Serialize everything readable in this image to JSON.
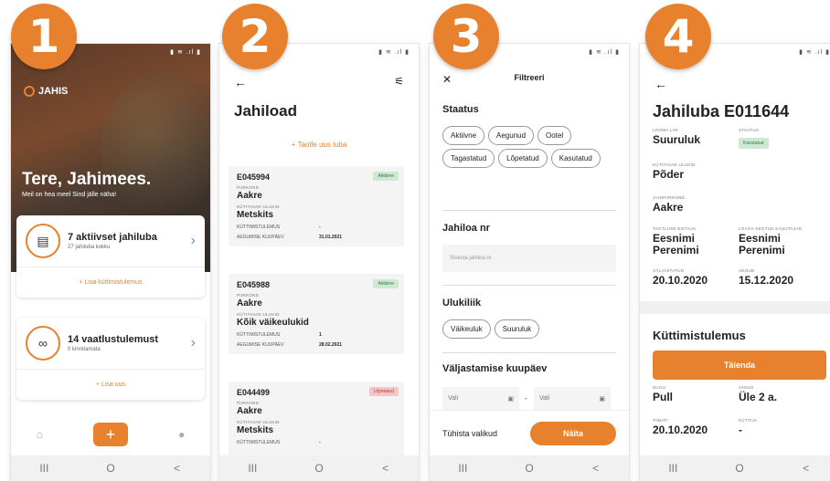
{
  "steps": [
    "1",
    "2",
    "3",
    "4"
  ],
  "icons": {
    "status": "status-icons",
    "nav": [
      "recent-apps-icon",
      "home-circle-icon",
      "back-chevron-icon"
    ]
  },
  "nav": {
    "recent": "III",
    "home": "O",
    "back": "<"
  },
  "screen1": {
    "brand": "JAHIS",
    "greeting": "Tere, Jahimees.",
    "greeting_sub": "Meil on hea meel Sind jälle näha!",
    "card_permits": {
      "title": "7 aktiivset jahiluba",
      "sub": "27 jahiluba kokku",
      "link": "+ Lisa küttimistulemus"
    },
    "card_observations": {
      "title": "14 vaatlustulemust",
      "sub": "0 kinnitamata",
      "link": "+ Lisa uus"
    },
    "fab": "+"
  },
  "screen2": {
    "title": "Jahiload",
    "apply_link": "+ Taotle uus luba",
    "labels": {
      "area": "PIIRKOND",
      "species": "KÜTITAVAD ULUKID",
      "result": "KÜTTIMISTULEMUS",
      "expires": "AEGUMISE KUUPÄEV"
    },
    "permits": [
      {
        "id": "E045994",
        "status": "Aktiivne",
        "area": "Aakre",
        "species": "Metskits",
        "result": "-",
        "expires": "31.01.2021",
        "type": "active"
      },
      {
        "id": "E045988",
        "status": "Aktiivne",
        "area": "Aakre",
        "species": "Kõik väikeulukid",
        "result": "1",
        "expires": "28.02.2021",
        "type": "active"
      },
      {
        "id": "E044499",
        "status": "Lõpetatud",
        "area": "Aakre",
        "species": "Metskits",
        "result": "-",
        "expires": "",
        "type": "closed"
      }
    ]
  },
  "screen3": {
    "title": "Filtreeri",
    "status_label": "Staatus",
    "statuses": [
      "Aktiivne",
      "Aegunud",
      "Ootel",
      "Tagastatud",
      "Lõpetatud",
      "Kasutatud"
    ],
    "permit_no_label": "Jahiloa nr",
    "permit_no_placeholder": "Sisesta jahiloa nr",
    "species_label": "Ulukiliik",
    "species": [
      "Väikeuluk",
      "Suuruluk"
    ],
    "date_label": "Väljastamise kuupäev",
    "date_from": "Vali",
    "date_to": "Vali",
    "date_sep": "-",
    "clear": "Tühista valikud",
    "show": "Näita"
  },
  "screen4": {
    "title": "Jahiluba E011644",
    "animal_type_label": "LOOMA LIIK",
    "animal_type": "Suuruluk",
    "status_label": "STAATUS",
    "status": "Kasutatud",
    "species_label": "KÜTITAVAD ULUKID",
    "species": "Põder",
    "area_label": "JAHIPIIRKOND",
    "area": "Aakre",
    "applicant_label": "TAOTLUSE ESITAJA",
    "applicant": "Eesnimi Perenimi",
    "user_label": "LOAGA SEOTUD KASUTAJAD",
    "user": "Eesnimi Perenimi",
    "issued_label": "VÄLJASTATUD",
    "issued": "20.10.2020",
    "expires_label": "AEGUB",
    "expires": "15.12.2020",
    "result_title": "Küttimistulemus",
    "fill_button": "Täienda",
    "sex_label": "SUGU",
    "sex": "Pull",
    "age_label": "VANUS",
    "age": "Üle 2 a.",
    "date_label": "TABATI",
    "date": "20.10.2020",
    "hunter_label": "KÜTTIJA",
    "hunter": "-"
  }
}
